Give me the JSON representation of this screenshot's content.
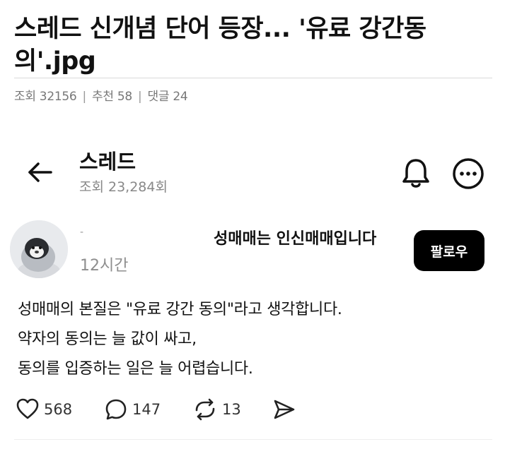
{
  "article": {
    "title": "스레드 신개념 단어 등장... '유료 강간동의'.jpg",
    "meta": {
      "views_label": "조회",
      "views": "32156",
      "likes_label": "추천",
      "likes": "58",
      "comments_label": "댓글",
      "comments": "24",
      "separator": "|"
    }
  },
  "thread_header": {
    "title": "스레드",
    "views": "조회 23,284회"
  },
  "post": {
    "author_redacted": "-",
    "headline": "성매매는 인신매매입니다",
    "follow_label": "팔로우",
    "time": "12시간",
    "body_lines": [
      "성매매의 본질은 \"유료 강간 동의\"라고 생각합니다.",
      "약자의 동의는 늘 값이 싸고,",
      "동의를 입증하는 일은 늘 어렵습니다."
    ],
    "actions": {
      "likes": "568",
      "comments": "147",
      "reposts": "13"
    }
  },
  "icons": {
    "back": "arrow-left-icon",
    "bell": "bell-icon",
    "more": "more-horizontal-icon",
    "like": "heart-icon",
    "comment": "comment-bubble-icon",
    "repost": "repost-icon",
    "share": "send-icon"
  },
  "colors": {
    "follow_button": "#000000",
    "muted_text": "#888888"
  }
}
